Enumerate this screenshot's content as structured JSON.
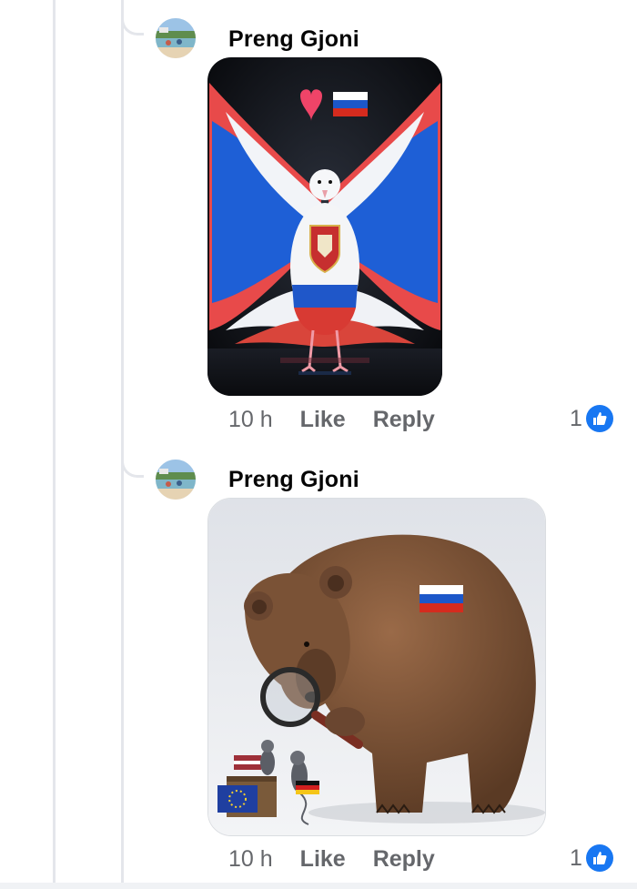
{
  "comments": [
    {
      "author": "Preng Gjoni",
      "avatar": "profile-photo-beach",
      "image": "dove-with-russian-flag-wings-and-serbian-coat-of-arms",
      "image_overlay": [
        "heart-emoji",
        "russian-flag-emoji"
      ],
      "time": "10 h",
      "like_label": "Like",
      "reply_label": "Reply",
      "reaction_count": "1",
      "reaction_icon": "thumbs-up-icon"
    },
    {
      "author": "Preng Gjoni",
      "avatar": "profile-photo-beach",
      "image": "brown-bear-with-magnifying-glass-looking-at-mice-with-eu-latvia-germany-flags",
      "time": "10 h",
      "like_label": "Like",
      "reply_label": "Reply",
      "reaction_count": "1",
      "reaction_icon": "thumbs-up-icon"
    }
  ],
  "colors": {
    "link_blue": "#1877f2",
    "meta_gray": "#65676b",
    "thread_line": "#e4e6eb",
    "name_black": "#050505"
  }
}
